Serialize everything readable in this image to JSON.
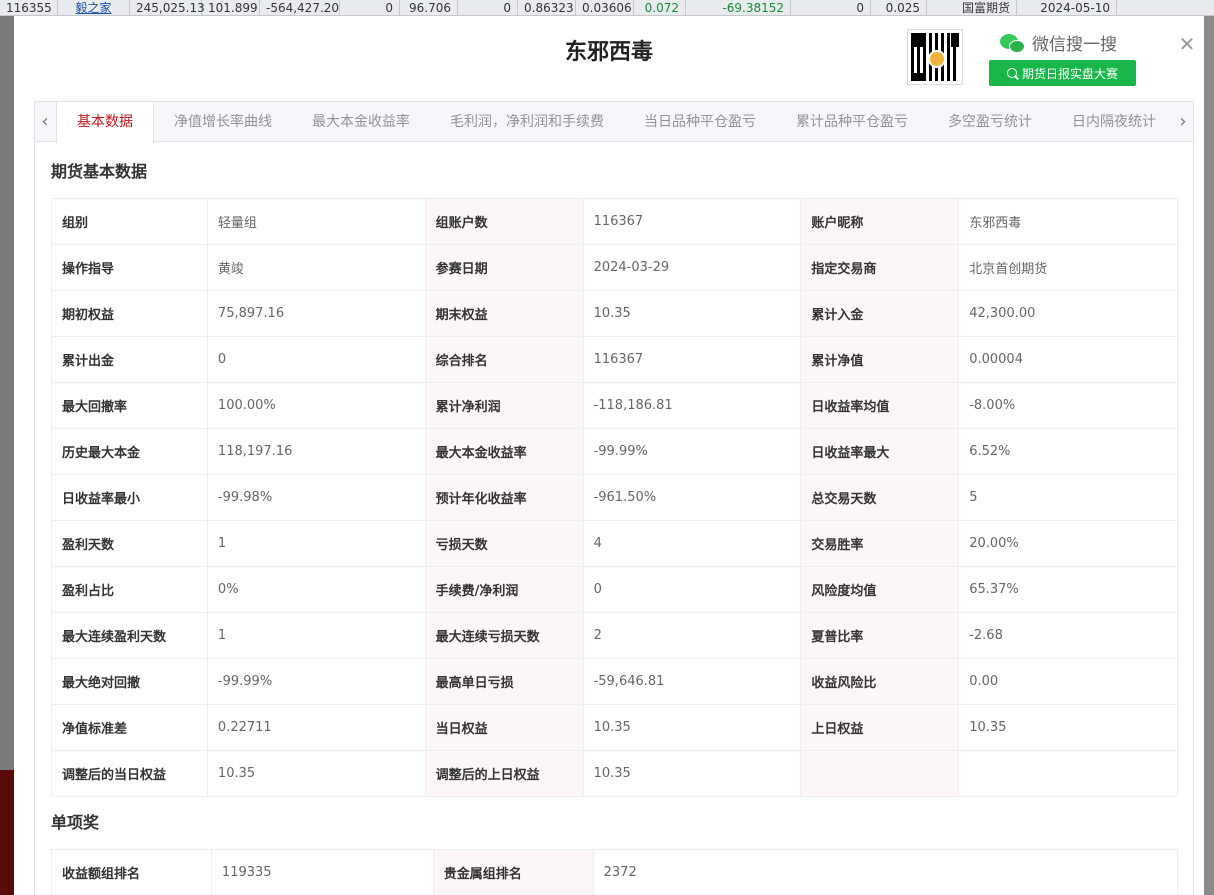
{
  "background_row": {
    "cells": [
      "116355",
      "毅之家",
      "245,025.13",
      "101.899",
      "-564,427.20",
      "0",
      "96.706",
      "0",
      "0.86323",
      "0.03606",
      "0.072",
      "-69.38152",
      "0",
      "0.025",
      "国富期货",
      "2024-05-10"
    ]
  },
  "modal": {
    "title": "东邪西毒",
    "close_icon": "close-icon",
    "wechat_label": "微信搜一搜",
    "wechat_button": "期货日报实盘大赛"
  },
  "tabs": [
    {
      "label": "基本数据",
      "active": true
    },
    {
      "label": "净值增长率曲线",
      "active": false
    },
    {
      "label": "最大本金收益率",
      "active": false
    },
    {
      "label": "毛利润，净利润和手续费",
      "active": false
    },
    {
      "label": "当日品种平仓盈亏",
      "active": false
    },
    {
      "label": "累计品种平仓盈亏",
      "active": false
    },
    {
      "label": "多空盈亏统计",
      "active": false
    },
    {
      "label": "日内隔夜统计",
      "active": false
    }
  ],
  "basic": {
    "title": "期货基本数据",
    "rows": [
      [
        {
          "k": "组别",
          "v": "轻量组"
        },
        {
          "k": "组账户数",
          "v": "116367"
        },
        {
          "k": "账户昵称",
          "v": "东邪西毒"
        }
      ],
      [
        {
          "k": "操作指导",
          "v": "黄竣"
        },
        {
          "k": "参赛日期",
          "v": "2024-03-29"
        },
        {
          "k": "指定交易商",
          "v": "北京首创期货"
        }
      ],
      [
        {
          "k": "期初权益",
          "v": "75,897.16"
        },
        {
          "k": "期末权益",
          "v": "10.35"
        },
        {
          "k": "累计入金",
          "v": "42,300.00"
        }
      ],
      [
        {
          "k": "累计出金",
          "v": "0"
        },
        {
          "k": "综合排名",
          "v": "116367"
        },
        {
          "k": "累计净值",
          "v": "0.00004"
        }
      ],
      [
        {
          "k": "最大回撤率",
          "v": "100.00%"
        },
        {
          "k": "累计净利润",
          "v": "-118,186.81"
        },
        {
          "k": "日收益率均值",
          "v": "-8.00%"
        }
      ],
      [
        {
          "k": "历史最大本金",
          "v": "118,197.16"
        },
        {
          "k": "最大本金收益率",
          "v": "-99.99%"
        },
        {
          "k": "日收益率最大",
          "v": "6.52%"
        }
      ],
      [
        {
          "k": "日收益率最小",
          "v": "-99.98%"
        },
        {
          "k": "预计年化收益率",
          "v": "-961.50%"
        },
        {
          "k": "总交易天数",
          "v": "5"
        }
      ],
      [
        {
          "k": "盈利天数",
          "v": "1"
        },
        {
          "k": "亏损天数",
          "v": "4"
        },
        {
          "k": "交易胜率",
          "v": "20.00%"
        }
      ],
      [
        {
          "k": "盈利占比",
          "v": "0%"
        },
        {
          "k": "手续费/净利润",
          "v": "0"
        },
        {
          "k": "风险度均值",
          "v": "65.37%"
        }
      ],
      [
        {
          "k": "最大连续盈利天数",
          "v": "1"
        },
        {
          "k": "最大连续亏损天数",
          "v": "2"
        },
        {
          "k": "夏普比率",
          "v": "-2.68"
        }
      ],
      [
        {
          "k": "最大绝对回撤",
          "v": "-99.99%"
        },
        {
          "k": "最高单日亏损",
          "v": "-59,646.81"
        },
        {
          "k": "收益风险比",
          "v": "0.00"
        }
      ],
      [
        {
          "k": "净值标准差",
          "v": "0.22711"
        },
        {
          "k": "当日权益",
          "v": "10.35"
        },
        {
          "k": "上日权益",
          "v": "10.35"
        }
      ],
      [
        {
          "k": "调整后的当日权益",
          "v": "10.35"
        },
        {
          "k": "调整后的上日权益",
          "v": "10.35"
        },
        {
          "k": "",
          "v": ""
        }
      ]
    ]
  },
  "awards": {
    "title": "单项奖",
    "rows": [
      [
        {
          "k": "收益额组排名",
          "v": "119335"
        },
        {
          "k": "贵金属组排名",
          "v": "2372"
        }
      ]
    ]
  }
}
